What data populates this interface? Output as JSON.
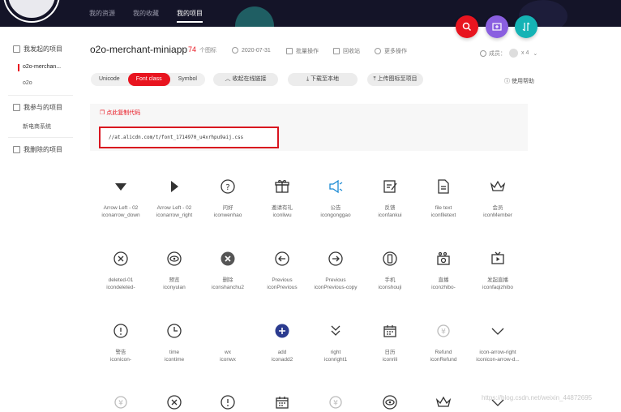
{
  "nav": {
    "items": [
      "我的资源",
      "我的收藏",
      "我的项目"
    ]
  },
  "sidebar": {
    "groups": [
      "我发起的项目",
      "我参与的项目",
      "我删除的项目"
    ],
    "items": [
      "o2o-merchan...",
      "o2o",
      "新电商系统"
    ]
  },
  "project": {
    "name": "o2o-merchant-miniapp",
    "count": "74",
    "count_unit": "个图标",
    "date": "2020-07-31",
    "batch": "批量操作",
    "recycle": "回收站",
    "more": "更多操作",
    "members_label": "成员：",
    "members_count": "x 4"
  },
  "toolbar": {
    "tabs": [
      "Unicode",
      "Font class",
      "Symbol"
    ],
    "collapse": "收起在线链接",
    "download": "下载至本地",
    "upload": "上传图标至项目",
    "help": "使用帮助"
  },
  "code": {
    "hint": "点此复制代码",
    "link": "//at.alicdn.com/t/font_1714970_u4xrhpu9aij.css"
  },
  "icons": [
    {
      "name": "Arrow Left - 02",
      "code": "iconarrow_down",
      "icon": "triangle-down-icon"
    },
    {
      "name": "Arrow Left - 02",
      "code": "iconarrow_right",
      "icon": "triangle-right-icon"
    },
    {
      "name": "问好",
      "code": "iconwenhao",
      "icon": "question-icon"
    },
    {
      "name": "邀请有礼",
      "code": "iconliwu",
      "icon": "gift-icon"
    },
    {
      "name": "公告",
      "code": "icongonggao",
      "icon": "speaker-icon"
    },
    {
      "name": "反馈",
      "code": "iconfankui",
      "icon": "feedback-icon"
    },
    {
      "name": "file text",
      "code": "iconfiletext",
      "icon": "file-text-icon"
    },
    {
      "name": "会员",
      "code": "iconMember",
      "icon": "crown-icon"
    },
    {
      "name": "deleted-01",
      "code": "icondeleted-",
      "icon": "x-circle-icon"
    },
    {
      "name": "预览",
      "code": "iconyulan",
      "icon": "eye-circle-icon"
    },
    {
      "name": "删除",
      "code": "iconshanchu2",
      "icon": "x-circle-filled-icon"
    },
    {
      "name": "Previous",
      "code": "iconPrevious",
      "icon": "arrow-left-circle-icon"
    },
    {
      "name": "Previous",
      "code": "iconPrevious-copy",
      "icon": "arrow-right-circle-icon"
    },
    {
      "name": "手机",
      "code": "iconshouji",
      "icon": "phone-circle-icon"
    },
    {
      "name": "直播",
      "code": "iconzhibo-",
      "icon": "camera-icon"
    },
    {
      "name": "发起直播",
      "code": "iconfaqizhibo",
      "icon": "tv-icon"
    },
    {
      "name": "警告",
      "code": "iconicon-",
      "icon": "warning-circle-icon"
    },
    {
      "name": "time",
      "code": "icontime",
      "icon": "clock-icon"
    },
    {
      "name": "wx",
      "code": "iconwx",
      "icon": "blank-icon"
    },
    {
      "name": "add",
      "code": "iconadd2",
      "icon": "plus-filled-icon"
    },
    {
      "name": "right",
      "code": "iconright1",
      "icon": "double-chevron-down-icon"
    },
    {
      "name": "日历",
      "code": "iconrili",
      "icon": "calendar-icon"
    },
    {
      "name": "Refund",
      "code": "iconRefund",
      "icon": "refund-icon"
    },
    {
      "name": "icon-arrow-right",
      "code": "iconicon-arrow-d...",
      "icon": "chevron-down-icon"
    }
  ],
  "watermark": "https://blog.csdn.net/weixin_44872695",
  "colors": {
    "accent": "#e8141f",
    "topbar": "#141428",
    "icon_blue": "#1a8ad4",
    "icon_navy": "#2b3b8f"
  }
}
